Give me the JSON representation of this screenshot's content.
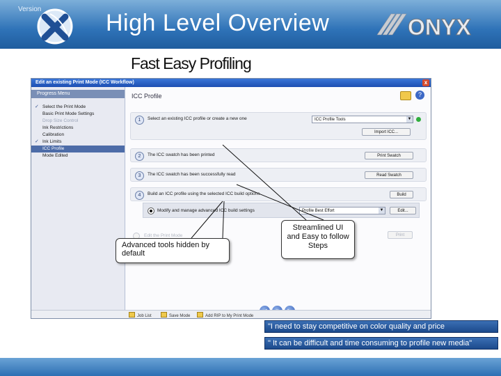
{
  "slide": {
    "version_label": "Version",
    "title": "High Level Overview",
    "subtitle": "Fast Easy Profiling",
    "brand": "ONYX"
  },
  "window": {
    "title": "Edit an existing Print Mode (ICC Workflow)",
    "close_glyph": "x"
  },
  "sidebar": {
    "heading": "Progress Menu",
    "items": [
      {
        "label": "Select the Print Mode",
        "state": "done"
      },
      {
        "label": "Basic Print Mode Settings",
        "state": "normal"
      },
      {
        "label": "Drop Size Control",
        "state": "dim"
      },
      {
        "label": "Ink Restrictions",
        "state": "normal"
      },
      {
        "label": "Calibration",
        "state": "normal"
      },
      {
        "label": "Ink Limits",
        "state": "done"
      },
      {
        "label": "ICC Profile",
        "state": "selected"
      },
      {
        "label": "Mode Edited",
        "state": "normal"
      }
    ]
  },
  "panel": {
    "title": "ICC Profile",
    "help_glyph": "?",
    "step1": {
      "num": "1",
      "text": "Select an existing ICC profile or create a new one",
      "dropdown": "ICC Profile Tools",
      "button": "Import ICC..."
    },
    "step2": {
      "num": "2",
      "text": "The ICC swatch has been printed",
      "button": "Print Swatch"
    },
    "step3": {
      "num": "3",
      "text": "The ICC swatch has been successfully read",
      "button": "Read Swatch"
    },
    "step4": {
      "num": "4",
      "text": "Build an ICC profile using the selected ICC build options",
      "button": "Build"
    },
    "advanced": {
      "text": "Modify and manage advanced ICC build settings",
      "dropdown": "Profile Best Effort",
      "button": "Edit..."
    },
    "faded": {
      "text": "Edit the Print Mode",
      "button": "Print"
    }
  },
  "navigation": {
    "back": "◀",
    "stop": "■",
    "forward": "▶"
  },
  "bottom_bar": {
    "items": [
      "Job List",
      "Save Mode",
      "Add RIP to My Print Mode"
    ]
  },
  "callouts": {
    "advanced_tools": "Advanced tools hidden by default",
    "streamlined": "Streamlined UI and Easy to follow Steps"
  },
  "quotes": [
    "\"I need to stay competitive on color quality and price",
    "\" It can be difficult and time consuming to profile new media\""
  ],
  "colors": {
    "header_blue": "#2f73b8",
    "quote_blue": "#1c4a8c",
    "selected_item": "#4d6ca8"
  }
}
